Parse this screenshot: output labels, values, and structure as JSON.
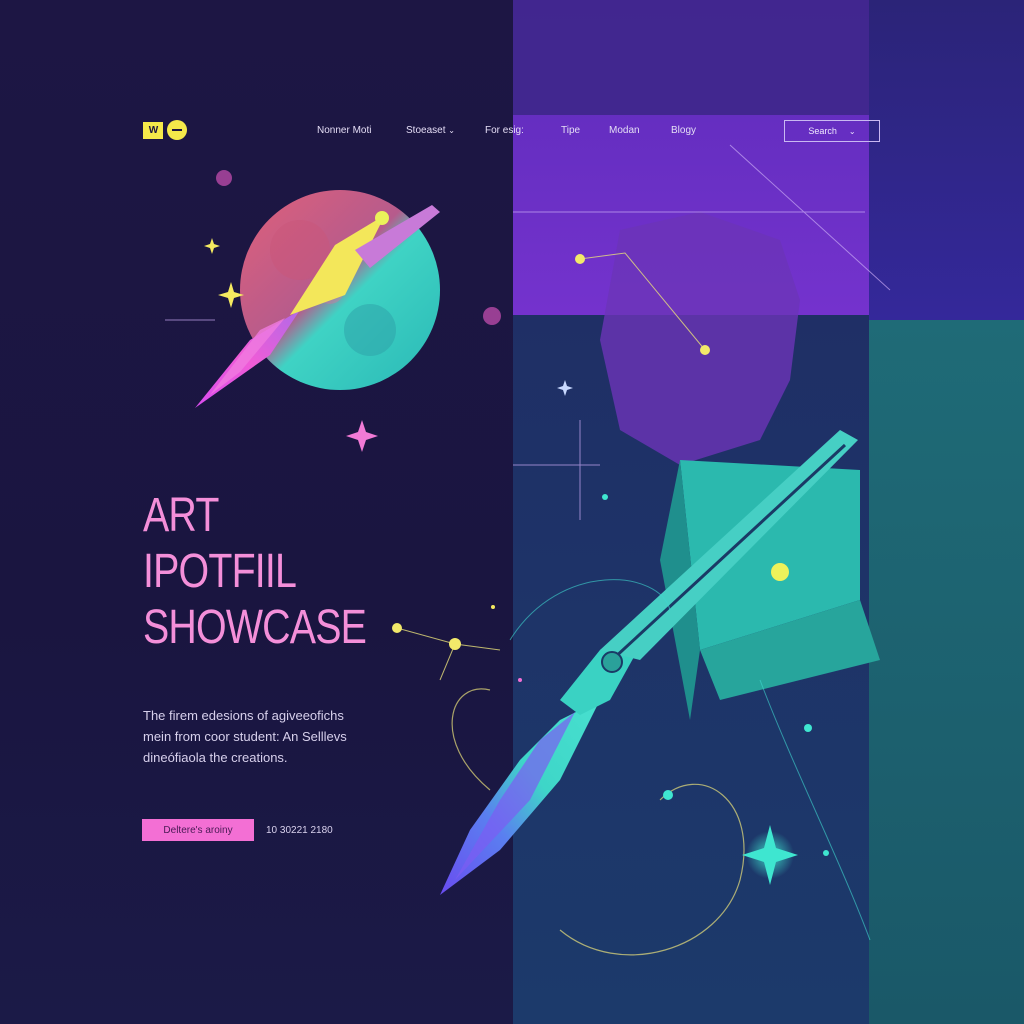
{
  "logo": {
    "mark_text": "W"
  },
  "nav": {
    "items": [
      {
        "label": "Nonner Moti"
      },
      {
        "label": "Stoeaset",
        "has_dropdown": true
      },
      {
        "label": "For esig:"
      },
      {
        "label": "Tipe"
      },
      {
        "label": "Modan"
      },
      {
        "label": "Blogy"
      }
    ],
    "search_label": "Search",
    "search_chevron": "⌄",
    "dropdown_chevron": "⌄"
  },
  "hero": {
    "title_lines": [
      "ART",
      "IPOTFIIL",
      "SHOWCASE"
    ],
    "description_lines": [
      "The firem edesions of agiveeofichs",
      "mein from coor student: An Selllevs",
      "dineófiaola the creations."
    ],
    "cta_label": "Deltere's aroiny",
    "cta_meta": "10 30221 2180"
  },
  "colors": {
    "background": "#1c1440",
    "accent_pink": "#f36fd4",
    "title_pink": "#f48fd9",
    "accent_yellow": "#f5e94a",
    "purple_panel": "#7b33d6",
    "teal_panel": "#1f6b77"
  },
  "icons": [
    "logo-icon",
    "chevron-down-icon",
    "paintbrush-illustration",
    "planet-illustration",
    "sparkle-icon"
  ]
}
